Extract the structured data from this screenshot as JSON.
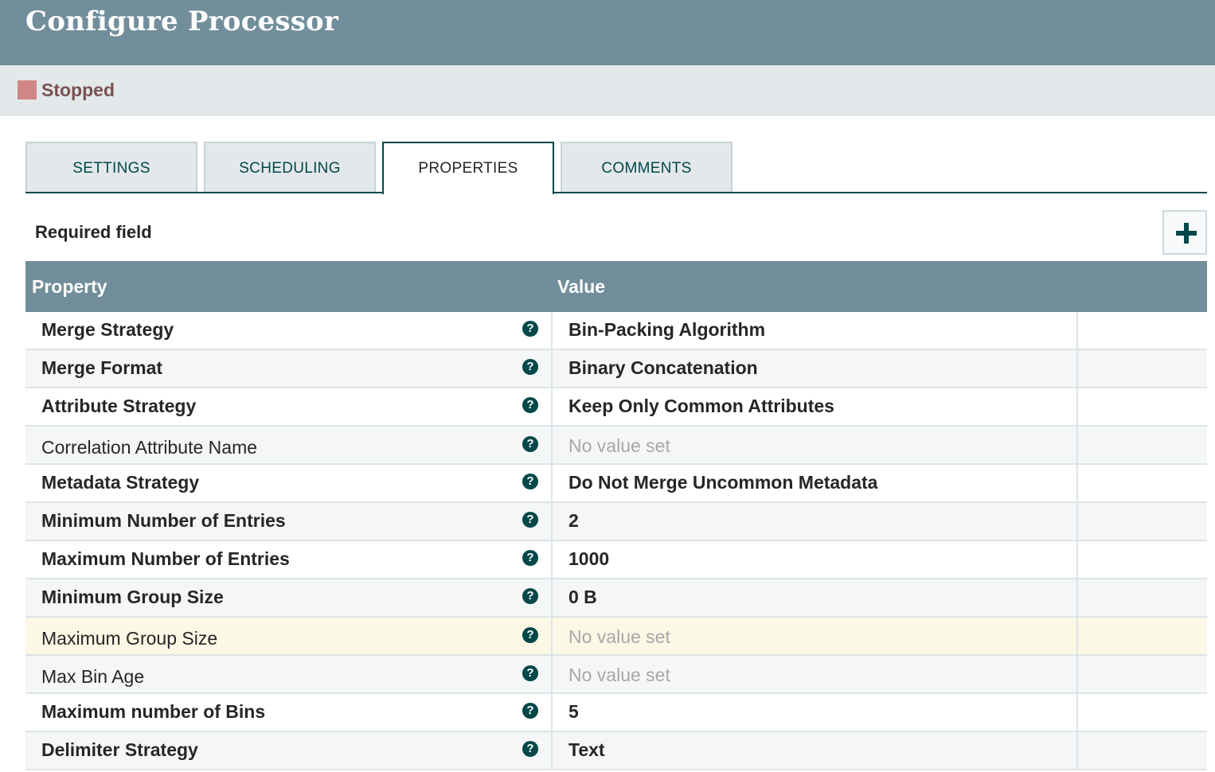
{
  "header": {
    "title": "Configure Processor"
  },
  "status": {
    "label": "Stopped",
    "color": "#d18686",
    "icon": "stopped-square-icon"
  },
  "tabs": [
    {
      "label": "SETTINGS",
      "active": false
    },
    {
      "label": "SCHEDULING",
      "active": false
    },
    {
      "label": "PROPERTIES",
      "active": true
    },
    {
      "label": "COMMENTS",
      "active": false
    }
  ],
  "properties_panel": {
    "required_label": "Required field",
    "add_button_icon": "plus-icon",
    "columns": {
      "property": "Property",
      "value": "Value"
    },
    "rows": [
      {
        "name": "Merge Strategy",
        "value": "Bin-Packing Algorithm",
        "required": true,
        "set": true
      },
      {
        "name": "Merge Format",
        "value": "Binary Concatenation",
        "required": true,
        "set": true
      },
      {
        "name": "Attribute Strategy",
        "value": "Keep Only Common Attributes",
        "required": true,
        "set": true
      },
      {
        "name": "Correlation Attribute Name",
        "value": "No value set",
        "required": false,
        "set": false
      },
      {
        "name": "Metadata Strategy",
        "value": "Do Not Merge Uncommon Metadata",
        "required": true,
        "set": true
      },
      {
        "name": "Minimum Number of Entries",
        "value": "2",
        "required": true,
        "set": true
      },
      {
        "name": "Maximum Number of Entries",
        "value": "1000",
        "required": true,
        "set": true
      },
      {
        "name": "Minimum Group Size",
        "value": "0 B",
        "required": true,
        "set": true
      },
      {
        "name": "Maximum Group Size",
        "value": "No value set",
        "required": false,
        "set": false
      },
      {
        "name": "Max Bin Age",
        "value": "No value set",
        "required": false,
        "set": false
      },
      {
        "name": "Maximum number of Bins",
        "value": "5",
        "required": true,
        "set": true
      },
      {
        "name": "Delimiter Strategy",
        "value": "Text",
        "required": true,
        "set": true
      }
    ],
    "help_icon_glyph": "?",
    "help_icon": "question-circle-icon"
  },
  "colors": {
    "header_bg": "#728e9b",
    "accent": "#004849",
    "status_bar_bg": "#e3e8eb",
    "highlight_row": "#fcf8e6"
  }
}
